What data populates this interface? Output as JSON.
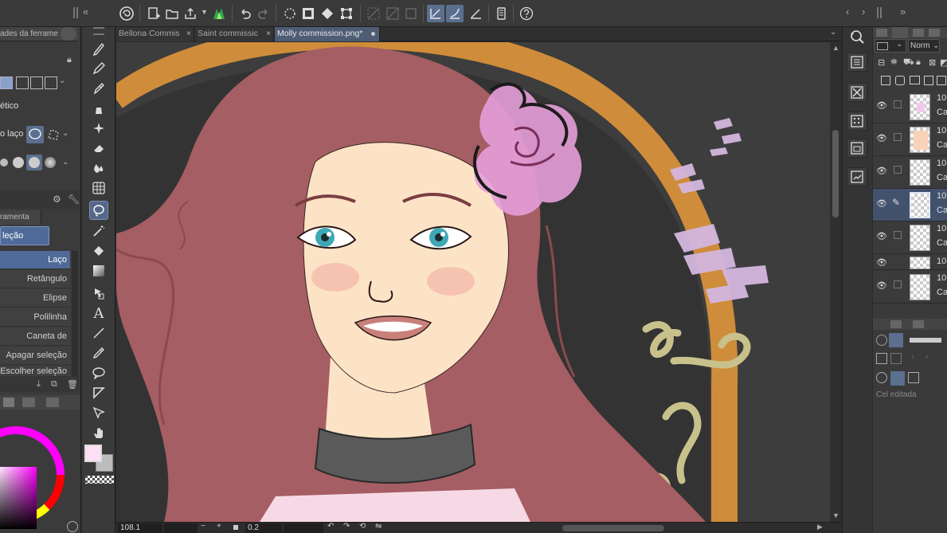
{
  "tabs": [
    {
      "label": "Bellona Commis"
    },
    {
      "label": "Saint commissic"
    },
    {
      "label": "Molly commission.png*"
    }
  ],
  "left_panel": {
    "top_tab": "ades da ferrame",
    "mode_label": "ético",
    "lasso_label": "o laço",
    "sub_tab": "ramenta",
    "group_label": "leção",
    "sub_tools": [
      "Laço",
      "Retângulo",
      "Elipse",
      "Polilinha",
      "Caneta de seleção",
      "Apagar seleção",
      "Escolher seleção"
    ]
  },
  "layers": {
    "blend_mode": "Norm",
    "rows": [
      {
        "pct": "10",
        "name": "Ca"
      },
      {
        "pct": "10",
        "name": "Ca"
      },
      {
        "pct": "10",
        "name": "Ca"
      },
      {
        "pct": "10",
        "name": "Ca"
      },
      {
        "pct": "10",
        "name": "Ca"
      },
      {
        "pct": "10",
        "name": "Ca"
      },
      {
        "pct": "10",
        "name": "Ca"
      }
    ],
    "cel_label": "Cel editada"
  },
  "status": {
    "zoom": "108.1",
    "angle": "0.2"
  },
  "colors": {
    "accent": "#55688a",
    "canvas_bg": "#3b3b3b",
    "hair": "#a55e63",
    "skin": "#fde3c6",
    "ring": "#cf8c3a",
    "flower": "#e69ed9",
    "choker": "#5a5a5a",
    "primary_color": "#fde0f6"
  }
}
